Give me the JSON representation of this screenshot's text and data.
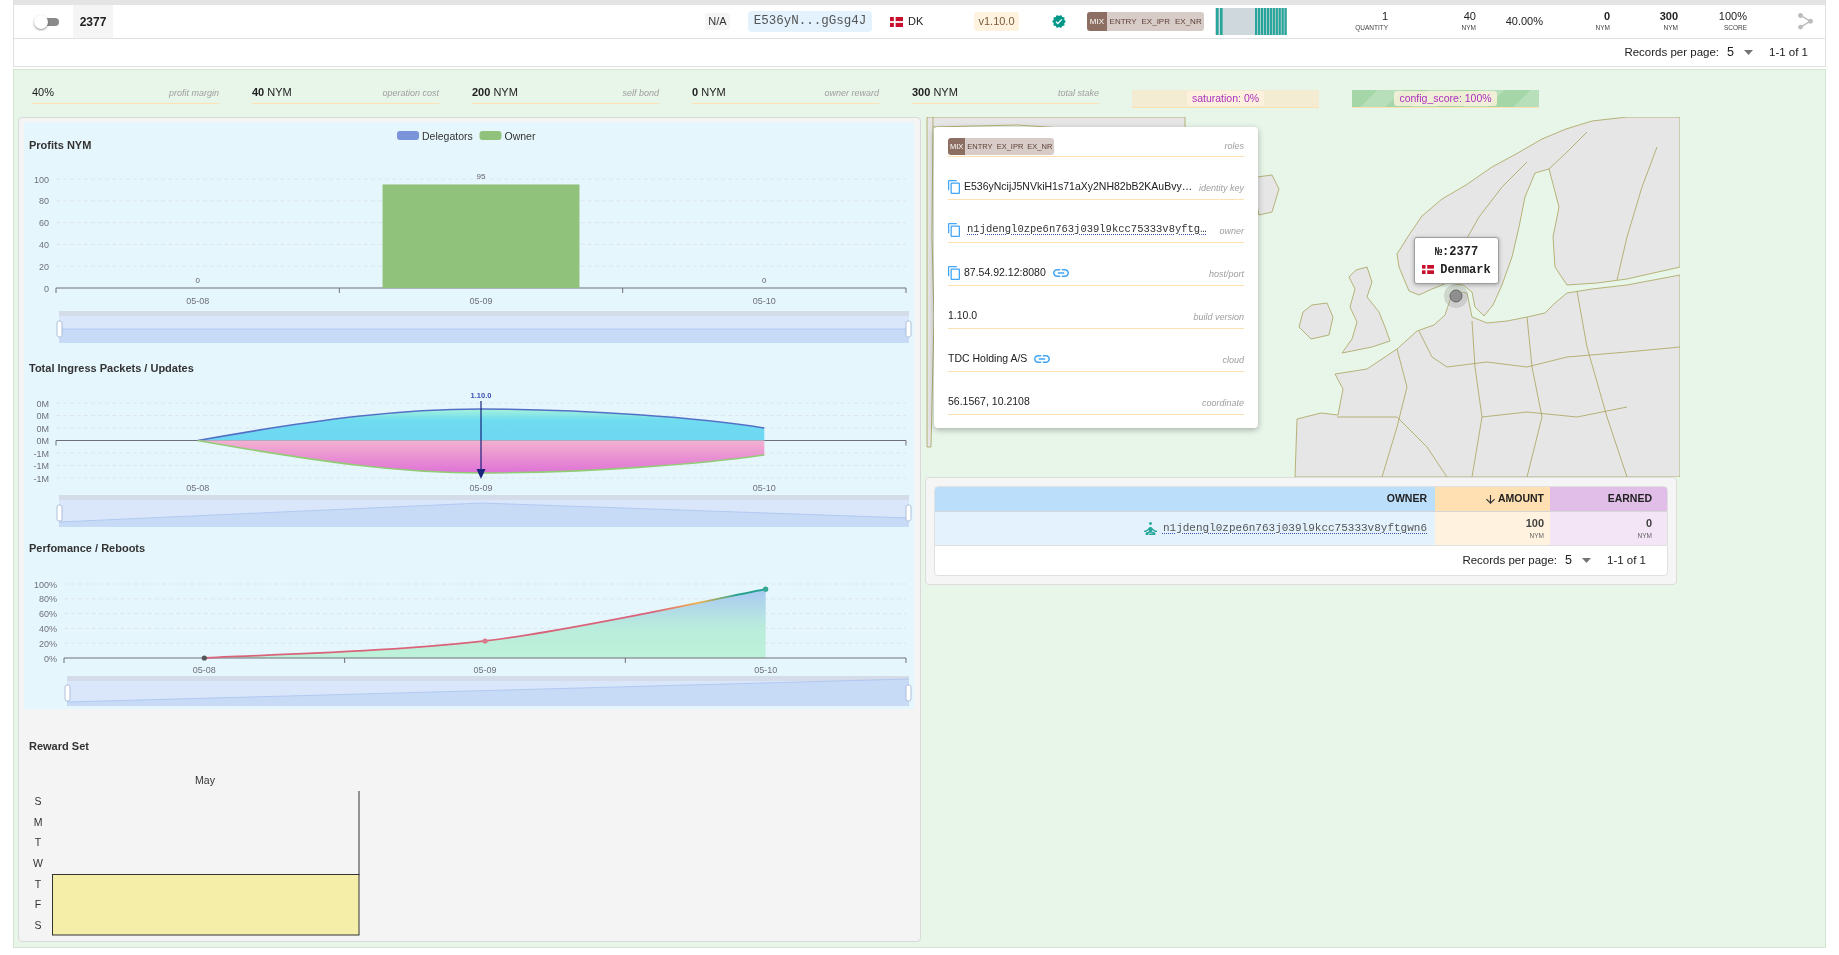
{
  "node_row": {
    "toggle_on": false,
    "id": "2377",
    "location": "N/A",
    "identity_key": "E536yN...gGsg4J",
    "country": "DK",
    "version": "v1.10.0",
    "verified": true,
    "roles": [
      {
        "label": "MIX",
        "active": true
      },
      {
        "label": "ENTRY",
        "active": false
      },
      {
        "label": "EX_IPR",
        "active": false
      },
      {
        "label": "EX_NR",
        "active": false
      }
    ],
    "metrics": [
      {
        "value": "1",
        "unit": "QUANTITY",
        "bold": false
      },
      {
        "value": "40",
        "unit": "NYM",
        "bold": false
      },
      {
        "value": "40.00%",
        "bold": false
      },
      {
        "value": "0",
        "unit": "NYM",
        "bold": true
      },
      {
        "value": "300",
        "unit": "NYM",
        "bold": true
      },
      {
        "value": "100%",
        "unit": "SCORE",
        "bold": false
      }
    ]
  },
  "pagination": {
    "label": "Records per page:",
    "per_page": "5",
    "range": "1-1 of 1"
  },
  "summary": {
    "stats": [
      {
        "amount": "40%",
        "caption": "profit margin"
      },
      {
        "amount": "**40** NYM",
        "caption": "operation cost"
      },
      {
        "amount": "**200** NYM",
        "caption": "self bond"
      },
      {
        "amount": "**0** NYM",
        "caption": "owner reward"
      },
      {
        "amount": "**300** NYM",
        "caption": "total stake"
      }
    ],
    "meters": [
      {
        "text": "saturation: 0%",
        "level": 0
      },
      {
        "text": "config_score: 100%",
        "level": 1
      }
    ]
  },
  "charts": {
    "profits": {
      "zoom_slider": {
        "level": 1
      },
      "chart_data": {
        "type": "bar",
        "title": "Profits NYM",
        "categories": [
          "05-08",
          "05-09",
          "05-10"
        ],
        "series": [
          {
            "name": "Delegators",
            "color": "#7b93d8",
            "values": [
              0,
              0,
              0
            ],
            "value_labels": [
              null,
              null,
              null
            ]
          },
          {
            "name": "Owner",
            "color": "#91c27b",
            "values": [
              0,
              95,
              0
            ],
            "value_labels": [
              "0",
              "95",
              "0"
            ]
          }
        ],
        "ylim": [
          0,
          100
        ],
        "yticks": [
          0,
          20,
          40,
          60,
          80,
          100
        ],
        "stacked": true,
        "grid": true
      }
    },
    "ingress": {
      "title": "Total Ingress Packets / Updates",
      "y_labels": [
        "0M",
        "0M",
        "0M",
        "0M",
        "-1M",
        "-1M",
        "-1M"
      ],
      "x_labels": [
        "05-08",
        "05-09",
        "05-10"
      ],
      "marker_label": "1.10.0",
      "zoom_slider": {
        "level": 1
      }
    },
    "performance": {
      "zoom_slider": {
        "level": 1
      },
      "chart_data": {
        "type": "area",
        "title": "Perfomance / Reboots",
        "categories": [
          "05-08",
          "05-09",
          "05-10"
        ],
        "values": [
          0,
          23,
          93
        ],
        "ylim": [
          0,
          100
        ],
        "yticks": [
          {
            "value": 0,
            "label": "0%"
          },
          {
            "value": 20,
            "label": "20%"
          },
          {
            "value": 40,
            "label": "40%"
          },
          {
            "value": 60,
            "label": "60%"
          },
          {
            "value": 80,
            "label": "80%"
          },
          {
            "value": 100,
            "label": "100%"
          }
        ],
        "grid": true
      }
    }
  },
  "reward_set": {
    "title": "Reward Set",
    "month": "May",
    "day_labels": [
      "S",
      "M",
      "T",
      "W",
      "T",
      "F",
      "S"
    ]
  },
  "node_details": {
    "roles": [
      {
        "label": "MIX",
        "active": true
      },
      {
        "label": "ENTRY",
        "active": false
      },
      {
        "label": "EX_IPR",
        "active": false
      },
      {
        "label": "EX_NR",
        "active": false
      }
    ],
    "roles_label": "roles",
    "rows": [
      {
        "kind": "text",
        "value": "E536yNcijJ5NVkiH1s71aXy2NH82bB2KAuBvy…",
        "label": "identity key",
        "copyable": true,
        "link": false
      },
      {
        "kind": "address",
        "value": "n1jdengl0zpe6n763j039l9kcc75333v8yftg…",
        "label": "owner",
        "copyable": true,
        "link": false
      },
      {
        "kind": "text",
        "value": "87.54.92.12:8080",
        "label": "host/port",
        "copyable": true,
        "link": true
      },
      {
        "kind": "text",
        "value": "1.10.0",
        "label": "build version",
        "copyable": false,
        "link": false
      },
      {
        "kind": "text",
        "value": "TDC Holding A/S",
        "label": "cloud",
        "copyable": false,
        "link": true
      },
      {
        "kind": "text",
        "value": "56.1567, 10.2108",
        "label": "coordinate",
        "copyable": false,
        "link": false
      }
    ]
  },
  "map": {
    "tooltip": {
      "number": "№:2377",
      "country": "Denmark"
    }
  },
  "delegations": {
    "columns": [
      {
        "label": "OWNER",
        "sorted": false
      },
      {
        "label": "AMOUNT",
        "sorted": true
      },
      {
        "label": "EARNED",
        "sorted": false
      }
    ],
    "rows": [
      {
        "owner": "n1jdengl0zpe6n763j039l9kcc75333v8yftgwn6",
        "amount": "100",
        "amount_unit": "NYM",
        "earned": "0",
        "earned_unit": "NYM"
      }
    ],
    "pagination": {
      "label": "Records per page:",
      "per_page": "5",
      "range": "1-1 of 1"
    }
  }
}
